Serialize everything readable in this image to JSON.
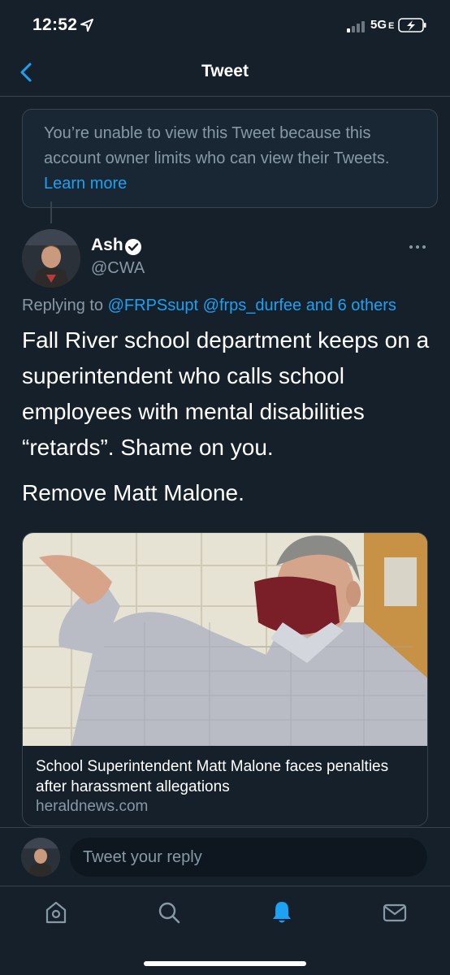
{
  "status_bar": {
    "time": "12:52",
    "network": "5G",
    "network_suffix": "E"
  },
  "header": {
    "title": "Tweet"
  },
  "notice": {
    "text": "You’re unable to view this Tweet because this account owner limits who can view their Tweets.",
    "link": "Learn more"
  },
  "tweet": {
    "author_name": "Ash",
    "author_handle": "@CWA",
    "replying_prefix": "Replying to",
    "mention1": "@FRPSsupt",
    "mention2": "@frps_durfee",
    "others": "and 6 others",
    "text": "Fall River school department keeps on a superintendent who calls school employees with mental disabilities “retards”. Shame on you.",
    "text2": "Remove Matt Malone."
  },
  "card": {
    "title": "School Superintendent Matt Malone faces penalties after harassment allegations",
    "domain": "heraldnews.com"
  },
  "reply": {
    "placeholder": "Tweet your reply"
  },
  "colors": {
    "background": "#15202b",
    "accent": "#1da1f2",
    "secondary_text": "#8899a6",
    "border": "#38444d"
  },
  "icons": [
    "location-arrow-icon",
    "signal-icon",
    "battery-charging-icon",
    "back-chevron-icon",
    "verified-icon",
    "more-icon",
    "home-icon",
    "search-icon",
    "notifications-bell-icon",
    "messages-mail-icon"
  ]
}
